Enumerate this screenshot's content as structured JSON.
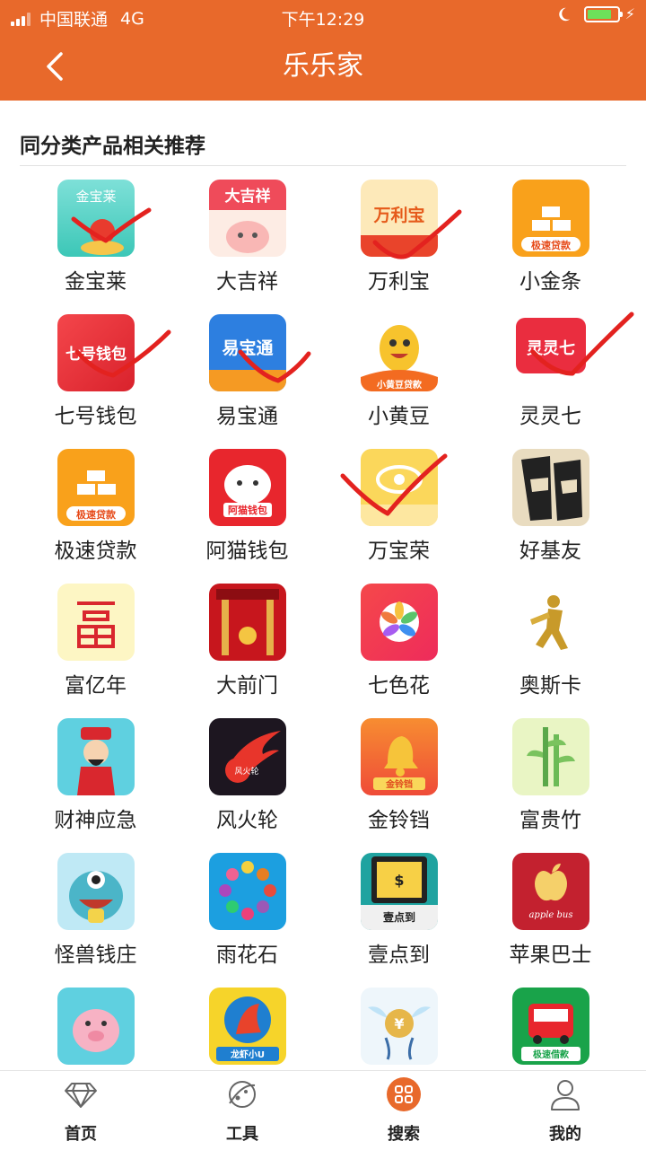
{
  "status_bar": {
    "carrier": "中国联通",
    "network": "4G",
    "time": "下午12:29"
  },
  "header": {
    "title": "乐乐家"
  },
  "section": {
    "title": "同分类产品相关推荐"
  },
  "apps": [
    {
      "name": "金宝莱",
      "icon_text": "金宝莱",
      "checked": true
    },
    {
      "name": "大吉祥",
      "icon_text": "大吉祥",
      "checked": false
    },
    {
      "name": "万利宝",
      "icon_text": "万利宝",
      "checked": true
    },
    {
      "name": "小金条",
      "icon_text": "极速贷款",
      "checked": false
    },
    {
      "name": "七号钱包",
      "icon_text": "七号钱包",
      "checked": true
    },
    {
      "name": "易宝通",
      "icon_text": "易宝通",
      "checked": true
    },
    {
      "name": "小黄豆",
      "icon_text": "小黄豆贷款",
      "checked": false
    },
    {
      "name": "灵灵七",
      "icon_text": "灵灵七",
      "checked": true
    },
    {
      "name": "极速贷款",
      "icon_text": "极速贷款",
      "checked": false
    },
    {
      "name": "阿猫钱包",
      "icon_text": "阿猫钱包",
      "checked": false
    },
    {
      "name": "万宝荣",
      "icon_text": "",
      "checked": true
    },
    {
      "name": "好基友",
      "icon_text": "",
      "checked": false
    },
    {
      "name": "富亿年",
      "icon_text": "",
      "checked": false
    },
    {
      "name": "大前门",
      "icon_text": "",
      "checked": false
    },
    {
      "name": "七色花",
      "icon_text": "",
      "checked": false
    },
    {
      "name": "奥斯卡",
      "icon_text": "",
      "checked": false
    },
    {
      "name": "财神应急",
      "icon_text": "",
      "checked": false
    },
    {
      "name": "风火轮",
      "icon_text": "风火轮",
      "checked": false
    },
    {
      "name": "金铃铛",
      "icon_text": "金铃铛",
      "checked": false
    },
    {
      "name": "富贵竹",
      "icon_text": "",
      "checked": false
    },
    {
      "name": "怪兽钱庄",
      "icon_text": "",
      "checked": false
    },
    {
      "name": "雨花石",
      "icon_text": "",
      "checked": false
    },
    {
      "name": "壹点到",
      "icon_text": "壹点到",
      "checked": false
    },
    {
      "name": "苹果巴士",
      "icon_text": "apple bus",
      "checked": false
    },
    {
      "name": "",
      "icon_text": "",
      "checked": false
    },
    {
      "name": "",
      "icon_text": "龙虾小U",
      "checked": false
    },
    {
      "name": "",
      "icon_text": "",
      "checked": false
    },
    {
      "name": "",
      "icon_text": "极速借款",
      "checked": false
    }
  ],
  "tabs": [
    {
      "label": "首页",
      "icon": "diamond-icon"
    },
    {
      "label": "工具",
      "icon": "planet-icon"
    },
    {
      "label": "搜索",
      "icon": "grid-icon"
    },
    {
      "label": "我的",
      "icon": "person-icon"
    }
  ],
  "colors": {
    "brand": "#e8692b",
    "check_mark": "#e3221f"
  }
}
